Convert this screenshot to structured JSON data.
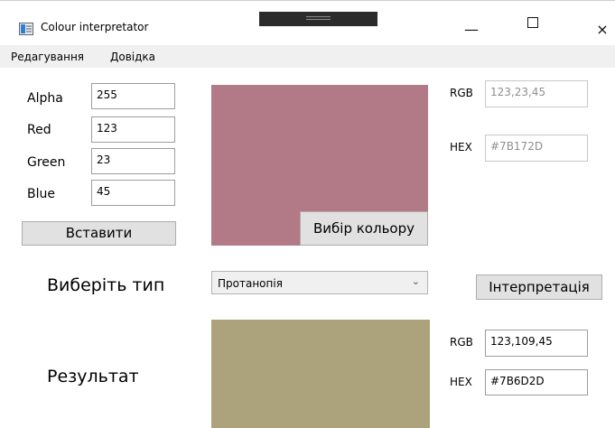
{
  "window": {
    "title": "Colour interpretator",
    "min_label": "—",
    "close_label": "×"
  },
  "menu": {
    "items": [
      "Редагування",
      "Довідка"
    ]
  },
  "input": {
    "alpha_label": "Alpha",
    "alpha": "255",
    "red_label": "Red",
    "red": "123",
    "green_label": "Green",
    "green": "23",
    "blue_label": "Blue",
    "blue": "45",
    "insert_button": "Вставити",
    "swatch_color": "#B27A86",
    "pick_color_button": "Вибір кольору",
    "rgb_label": "RGB",
    "rgb": "123,23,45",
    "hex_label": "HEX",
    "hex": "#7B172D"
  },
  "type": {
    "label": "Виберіть тип",
    "selected": "Протанопія",
    "interpret_button": "Інтерпретація"
  },
  "result": {
    "label": "Результат",
    "swatch_color": "#ACA27B",
    "rgb_label": "RGB",
    "rgb": "123,109,45",
    "hex_label": "HEX",
    "hex": "#7B6D2D"
  }
}
